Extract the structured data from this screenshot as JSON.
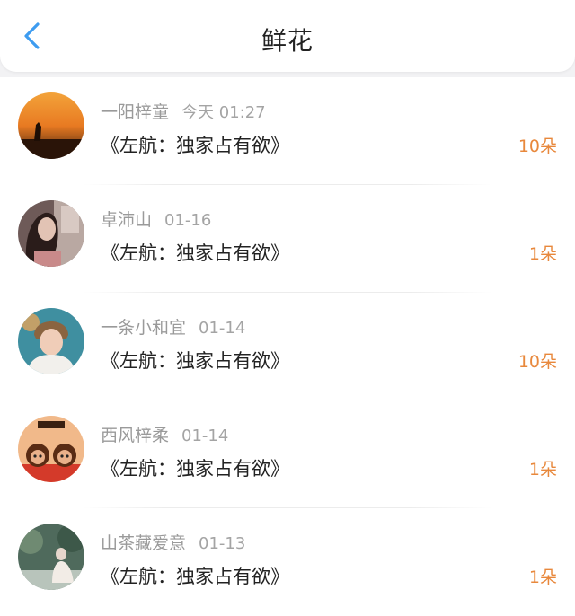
{
  "header": {
    "title": "鲜花",
    "back_icon": "chevron-left-icon",
    "accent": "#3d9cf0"
  },
  "count_color": "#e8883c",
  "rows": [
    {
      "user": "一阳梓童",
      "time": "今天 01:27",
      "book": "《左航：独家占有欲》",
      "count": "10朵"
    },
    {
      "user": "卓沛山",
      "time": "01-16",
      "book": "《左航：独家占有欲》",
      "count": "1朵"
    },
    {
      "user": "一条小和宜",
      "time": "01-14",
      "book": "《左航：独家占有欲》",
      "count": "10朵"
    },
    {
      "user": "西风梓柔",
      "time": "01-14",
      "book": "《左航：独家占有欲》",
      "count": "1朵"
    },
    {
      "user": "山茶藏爱意",
      "time": "01-13",
      "book": "《左航：独家占有欲》",
      "count": "1朵"
    }
  ]
}
